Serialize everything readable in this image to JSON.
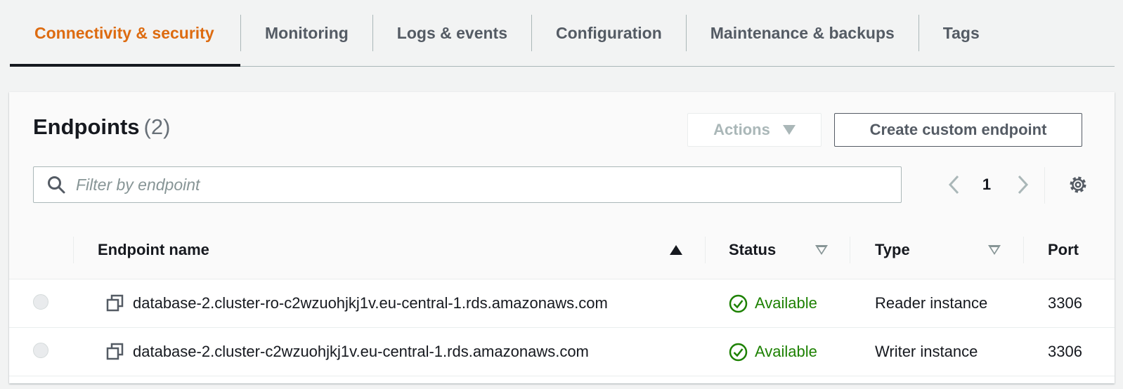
{
  "tabs": [
    {
      "label": "Connectivity & security",
      "active": true
    },
    {
      "label": "Monitoring"
    },
    {
      "label": "Logs & events"
    },
    {
      "label": "Configuration"
    },
    {
      "label": "Maintenance & backups"
    },
    {
      "label": "Tags"
    }
  ],
  "endpoints": {
    "title": "Endpoints",
    "count": "(2)",
    "actions_label": "Actions",
    "create_label": "Create custom endpoint",
    "search_placeholder": "Filter by endpoint",
    "page": "1",
    "columns": {
      "name": "Endpoint name",
      "status": "Status",
      "type": "Type",
      "port": "Port"
    },
    "rows": [
      {
        "name": "database-2.cluster-ro-c2wzuohjkj1v.eu-central-1.rds.amazonaws.com",
        "status": "Available",
        "type": "Reader instance",
        "port": "3306"
      },
      {
        "name": "database-2.cluster-c2wzuohjkj1v.eu-central-1.rds.amazonaws.com",
        "status": "Available",
        "type": "Writer instance",
        "port": "3306"
      }
    ]
  },
  "colors": {
    "accent": "#dd6b10",
    "success": "#1d8102",
    "text": "#16191f",
    "muted": "#545b64"
  },
  "icons": [
    "search-icon",
    "chevron-left-icon",
    "chevron-right-icon",
    "gear-icon",
    "copy-icon",
    "check-circle-icon",
    "sort-ascending-icon",
    "sort-descending-icon",
    "caret-down-icon"
  ]
}
